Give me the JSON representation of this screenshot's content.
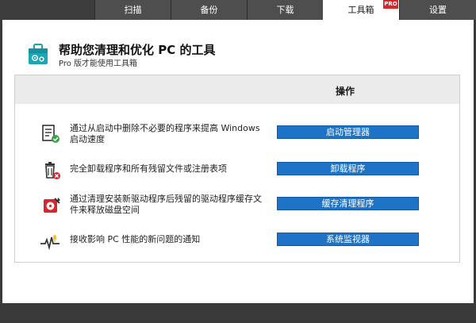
{
  "tabs": [
    {
      "label": "扫描"
    },
    {
      "label": "备份"
    },
    {
      "label": "下载"
    },
    {
      "label": "工具箱"
    },
    {
      "label": "设置"
    }
  ],
  "pro_badge": "PRO",
  "header": {
    "title": "帮助您清理和优化 PC 的工具",
    "subtitle": "Pro 版才能使用工具箱"
  },
  "table": {
    "column_header": "操作",
    "rows": [
      {
        "icon": "startup-manager-icon",
        "description": "通过从启动中删除不必要的程序来提高 Windows 启动速度",
        "action": "启动管理器"
      },
      {
        "icon": "uninstaller-icon",
        "description": "完全卸载程序和所有残留文件或注册表项",
        "action": "卸载程序"
      },
      {
        "icon": "cache-cleaner-icon",
        "description": "通过清理安装新驱动程序后残留的驱动程序缓存文件来释放磁盘空间",
        "action": "缓存清理程序"
      },
      {
        "icon": "system-monitor-icon",
        "description": "接收影响 PC 性能的新问题的通知",
        "action": "系统监视器"
      }
    ]
  },
  "colors": {
    "accent_button": "#1e73c6",
    "pro_badge": "#d7262c",
    "dark_frame": "#3a3a3a",
    "toolbox_icon": "#19a7b6"
  }
}
